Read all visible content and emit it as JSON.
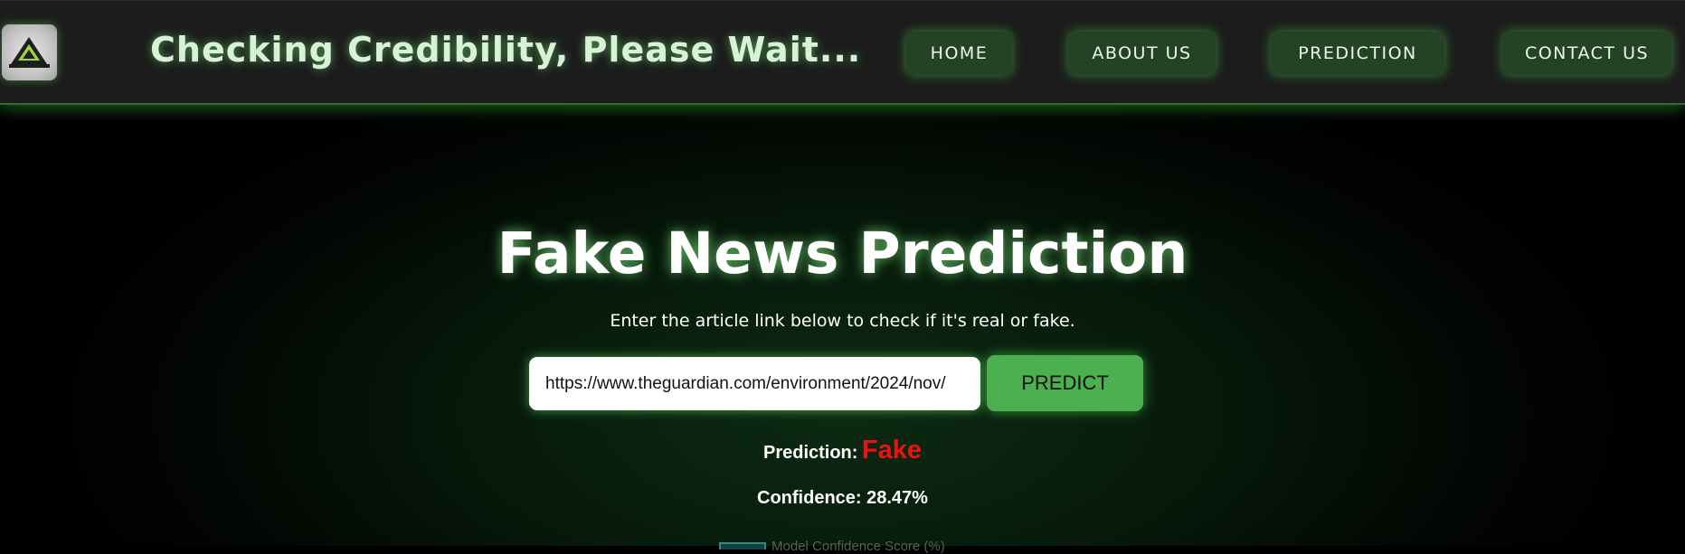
{
  "header": {
    "title": "Checking Credibility, Please Wait...",
    "nav": {
      "home": "HOME",
      "about": "ABOUT US",
      "prediction": "PREDICTION",
      "contact": "CONTACT US"
    }
  },
  "main": {
    "title": "Fake News Prediction",
    "subtitle": "Enter the article link below to check if it's real or fake.",
    "url_input_value": "https://www.theguardian.com/environment/2024/nov/",
    "predict_button": "PREDICT",
    "prediction_label": "Prediction:",
    "prediction_value": "Fake",
    "confidence_text": "Confidence: 28.47%",
    "chart_legend_label": "Model Confidence Score (%)"
  },
  "colors": {
    "accent_green": "#4caf50",
    "fake_red": "#ee1111",
    "header_bg": "#1c1c1c"
  },
  "icons": {
    "logo": "triangle-mountain-logo"
  }
}
